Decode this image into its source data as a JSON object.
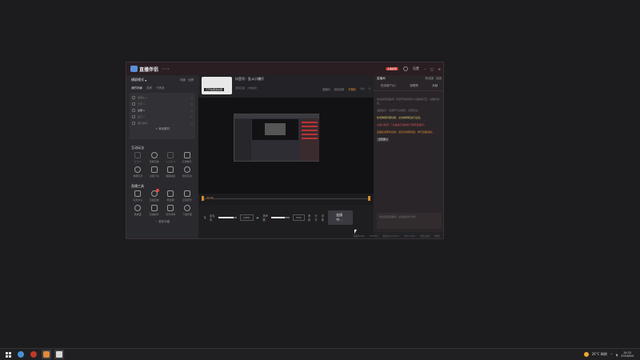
{
  "app": {
    "title": "直播伴侣",
    "version": "v7.1.8",
    "live_tag": "主播权限",
    "settings_label": "设置",
    "window_controls": [
      "minimize-icon",
      "maximize-icon",
      "close-icon"
    ]
  },
  "left_panel": {
    "mode_label": "横屏模式",
    "mode_actions": [
      "场景",
      "全屏"
    ],
    "source_tabs": [
      "我的场景",
      "竖屏",
      "只看我"
    ],
    "active_source_tab": "我的场景",
    "scenes": [
      {
        "label": "摄像头 1",
        "right": "◎"
      },
      {
        "label": "文字 1",
        "right": "◎"
      },
      {
        "label": "全屏 1",
        "right": "◎",
        "active": true
      },
      {
        "label": "窗口 1",
        "right": "◎"
      },
      {
        "label": "图片素材",
        "right": "◎"
      }
    ],
    "add_source": "+ 添加素材",
    "interactive_title": "互动玩法",
    "interactive_tools": [
      {
        "label": "连线PK",
        "dim": true,
        "icon": "mic-icon"
      },
      {
        "label": "观看直播",
        "dim": false,
        "icon": "shield-icon"
      },
      {
        "label": "全站联动",
        "dim": true,
        "icon": "link-icon"
      },
      {
        "label": "礼物展示",
        "dim": false,
        "icon": "gift-icon"
      },
      {
        "label": "弹幕玩法",
        "dim": false,
        "icon": "upload-icon"
      },
      {
        "label": "主播门派",
        "dim": false,
        "icon": "users-icon"
      },
      {
        "label": "福袋抽奖",
        "dim": false,
        "icon": "badge-icon"
      },
      {
        "label": "游戏互动",
        "dim": false,
        "icon": "game-icon"
      }
    ],
    "tools_title": "直播工具",
    "live_tools": [
      {
        "label": "任务中心",
        "icon": "clipboard-icon",
        "dot": false
      },
      {
        "label": "直播回放",
        "icon": "record-icon",
        "dot": true
      },
      {
        "label": "粉丝群",
        "icon": "fans-icon",
        "dot": false
      },
      {
        "label": "正版音乐",
        "icon": "download-icon",
        "dot": false
      },
      {
        "label": "数据面",
        "icon": "data-icon",
        "dot": false
      },
      {
        "label": "直播助手",
        "icon": "assistant-icon",
        "dot": false
      },
      {
        "label": "场景特效",
        "icon": "effects-icon",
        "dot": false
      },
      {
        "label": "下播管理",
        "icon": "manage-icon",
        "dot": false
      }
    ],
    "more_label": "⋯ 更多功能"
  },
  "room": {
    "cover_tag": "已开启更改标题",
    "title": "抖音号：乱斗小爆仔",
    "category": "游戏直播",
    "sub_tags": [
      "游戏直播",
      "大放映室"
    ],
    "actions": [
      "直播间",
      "道具设置",
      "开播前"
    ],
    "stats": [
      "141",
      "0"
    ]
  },
  "timeline": {
    "label": "00:00"
  },
  "controls": {
    "mic_label": "麦克风",
    "mic_value": "100%",
    "speaker_label": "扬声器",
    "zoom_value": "51%",
    "beauty_label": "美颜",
    "share_label": "分享",
    "settings_label": "设置",
    "start_button": "连接中...",
    "mic_level": 0.85,
    "speaker_level": 0.72
  },
  "status_bar": [
    "直播0KB/s",
    "FPS:60",
    "丢帧:0(0.00%)",
    "CPU:18%",
    "内存占用",
    "帧/秒"
  ],
  "right_panel": {
    "header_items": [
      "直播间",
      "粉丝团",
      "连线"
    ],
    "tabs": [
      "在线用户(0)",
      "观看榜",
      "贡献"
    ],
    "messages": [
      {
        "text": "欢迎来到直播间！抖音严禁未成年人直播或打赏，请理性消费。",
        "cls": ""
      },
      {
        "text": "温馨提示：请遵守平台规则，文明互动。",
        "cls": ""
      },
      {
        "text": "新增弹幕管理功能，点击弹幕框进行设置。",
        "cls": "y"
      },
      {
        "text": "主播小助手：「主播提示当前处于游戏直播间」",
        "cls": "r"
      },
      {
        "text": "直播任务即将完成，请及时领取奖励，参与直播活动。",
        "cls": "o"
      },
      {
        "text": "去查看 ▸",
        "cls": "chip"
      }
    ],
    "input_hint": "欢迎来到直播间，点击说点什么吧..."
  },
  "taskbar": {
    "apps": [
      "chrome-icon",
      "media-icon",
      "orange-app-icon",
      "file-icon"
    ],
    "weather": "26°C 晴朗",
    "time": "14:22",
    "date": "2024/6/4"
  }
}
